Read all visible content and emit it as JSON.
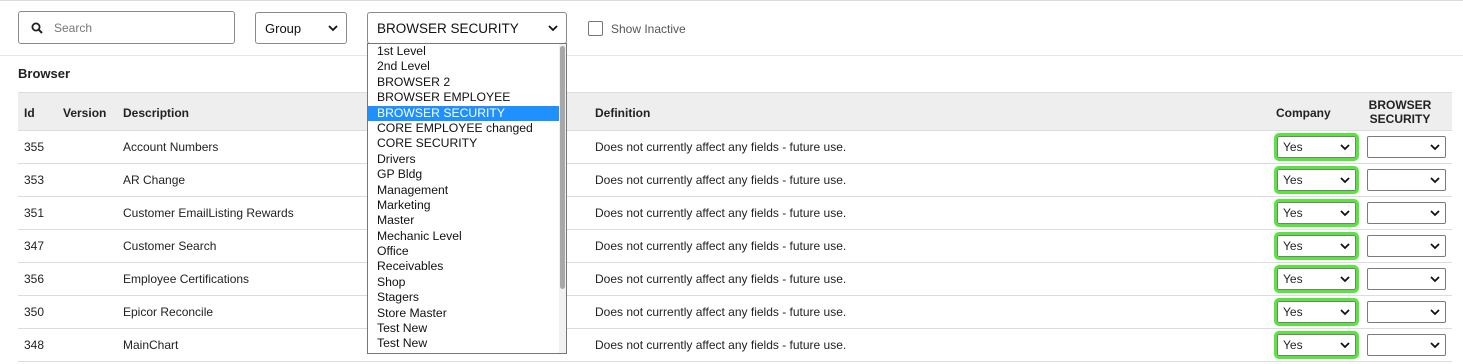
{
  "toolbar": {
    "search_placeholder": "Search",
    "group_select_value": "Group",
    "role_select_value": "BROWSER SECURITY",
    "show_inactive_label": "Show Inactive"
  },
  "section_title": "Browser",
  "columns": {
    "id": "Id",
    "version": "Version",
    "description": "Description",
    "definition": "Definition",
    "company": "Company",
    "browser_security_line1": "BROWSER",
    "browser_security_line2": "SECURITY"
  },
  "rows": [
    {
      "id": "355",
      "version": "",
      "description": "Account Numbers",
      "definition": "Does not currently affect any fields - future use.",
      "company": "Yes",
      "browser_security": ""
    },
    {
      "id": "353",
      "version": "",
      "description": "AR Change",
      "definition": "Does not currently affect any fields - future use.",
      "company": "Yes",
      "browser_security": ""
    },
    {
      "id": "351",
      "version": "",
      "description": "Customer EmailListing Rewards",
      "definition": "Does not currently affect any fields - future use.",
      "company": "Yes",
      "browser_security": ""
    },
    {
      "id": "347",
      "version": "",
      "description": "Customer Search",
      "definition": "Does not currently affect any fields - future use.",
      "company": "Yes",
      "browser_security": ""
    },
    {
      "id": "356",
      "version": "",
      "description": "Employee Certifications",
      "definition": "Does not currently affect any fields - future use.",
      "company": "Yes",
      "browser_security": ""
    },
    {
      "id": "350",
      "version": "",
      "description": "Epicor Reconcile",
      "definition": "Does not currently affect any fields - future use.",
      "company": "Yes",
      "browser_security": ""
    },
    {
      "id": "348",
      "version": "",
      "description": "MainChart",
      "definition": "Does not currently affect any fields - future use.",
      "company": "Yes",
      "browser_security": ""
    }
  ],
  "dropdown_options": [
    "1st Level",
    "2nd Level",
    "BROWSER 2",
    "BROWSER EMPLOYEE",
    "BROWSER SECURITY",
    "CORE EMPLOYEE changed",
    "CORE SECURITY",
    "Drivers",
    "GP Bldg",
    "Management",
    "Marketing",
    "Master",
    "Mechanic Level",
    "Office",
    "Receivables",
    "Shop",
    "Stagers",
    "Store Master",
    "Test New",
    "Test New"
  ],
  "dropdown_selected_index": 4,
  "colors": {
    "highlight_outline": "#55e83a",
    "selected_option": "#1e90ff",
    "header_bg": "#eeeeee"
  },
  "icons": {
    "search": "search-icon",
    "caret": "chevron-down-icon"
  }
}
